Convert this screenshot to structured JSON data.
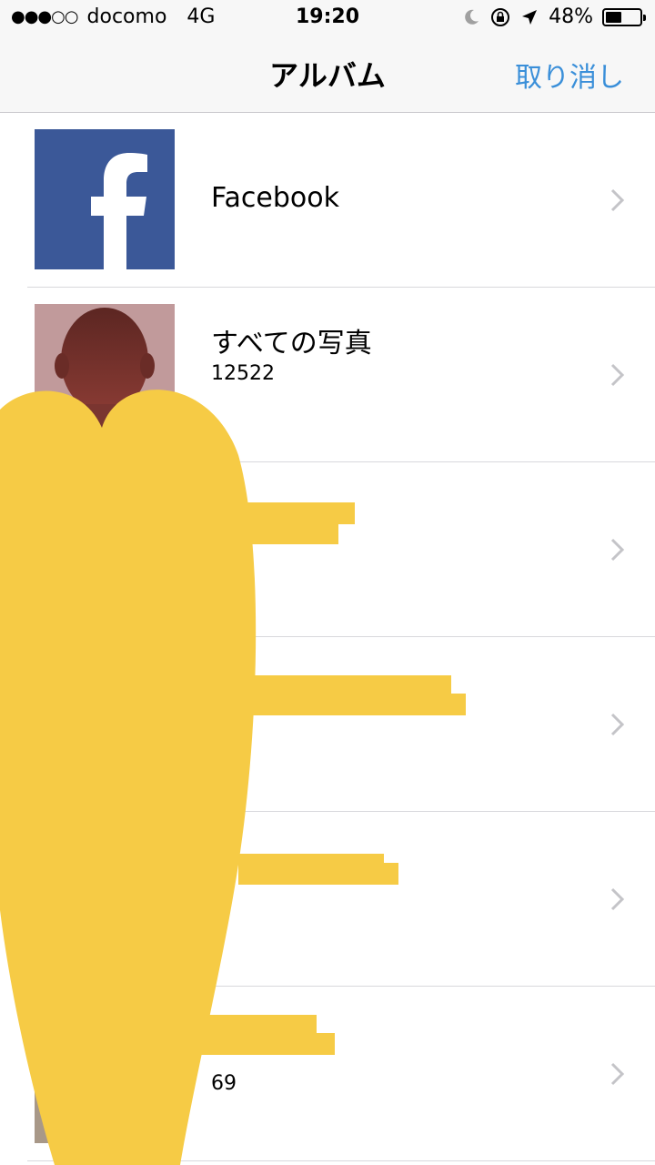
{
  "status_bar": {
    "signal": "●●●○○",
    "carrier": "docomo",
    "network": "4G",
    "time": "19:20",
    "battery": "48%",
    "battery_level": 0.48
  },
  "nav": {
    "title": "アルバム",
    "cancel_label": "取り消し"
  },
  "albums": [
    {
      "title": "Facebook",
      "count": ""
    },
    {
      "title": "すべての写真",
      "count": "12522"
    },
    {
      "title": "",
      "count": ""
    },
    {
      "title": "",
      "count": ""
    },
    {
      "title": "",
      "count": ""
    },
    {
      "title": "",
      "count": "69"
    }
  ],
  "colors": {
    "accent": "#3a8fd9",
    "facebook_blue": "#3b5898",
    "redaction_yellow": "#f6cb45"
  }
}
